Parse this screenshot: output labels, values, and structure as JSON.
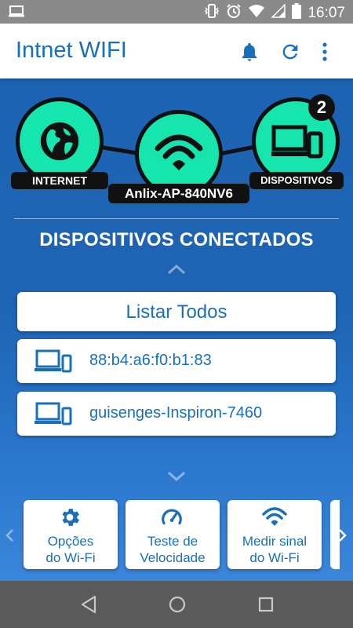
{
  "status_bar": {
    "time": "16:07",
    "icons": [
      "laptop-icon",
      "vibrate-icon",
      "alarm-icon",
      "wifi-icon",
      "signal-icon",
      "battery-icon"
    ]
  },
  "app_bar": {
    "title": "Intnet WIFI",
    "actions": [
      "bell-icon",
      "refresh-icon",
      "more-vert-icon"
    ]
  },
  "topology": {
    "internet_label": "INTERNET",
    "router_label": "Anlix-AP-840NV6",
    "devices_label": "DISPOSITIVOS",
    "devices_count": "2"
  },
  "connected": {
    "title": "DISPOSITIVOS CONECTADOS",
    "list_all_label": "Listar Todos",
    "devices": [
      {
        "name": "88:b4:a6:f0:b1:83",
        "icon": "devices-icon"
      },
      {
        "name": "guisenges-Inspiron-7460",
        "icon": "devices-icon"
      }
    ]
  },
  "bottom_actions": [
    {
      "label_line1": "Opções",
      "label_line2": "do Wi-Fi",
      "icon": "gear-icon"
    },
    {
      "label_line1": "Teste de",
      "label_line2": "Velocidade",
      "icon": "speedometer-icon"
    },
    {
      "label_line1": "Medir sinal",
      "label_line2": "do Wi-Fi",
      "icon": "wifi-icon"
    }
  ],
  "nav_bar": [
    "back-icon",
    "home-icon",
    "recents-icon"
  ],
  "colors": {
    "accent": "#1a6fb9",
    "node_green": "#17e5ae",
    "background_blue": "#1c63b3",
    "status_bar": "#8a8a8a",
    "nav_bar": "#5a5a5a"
  }
}
